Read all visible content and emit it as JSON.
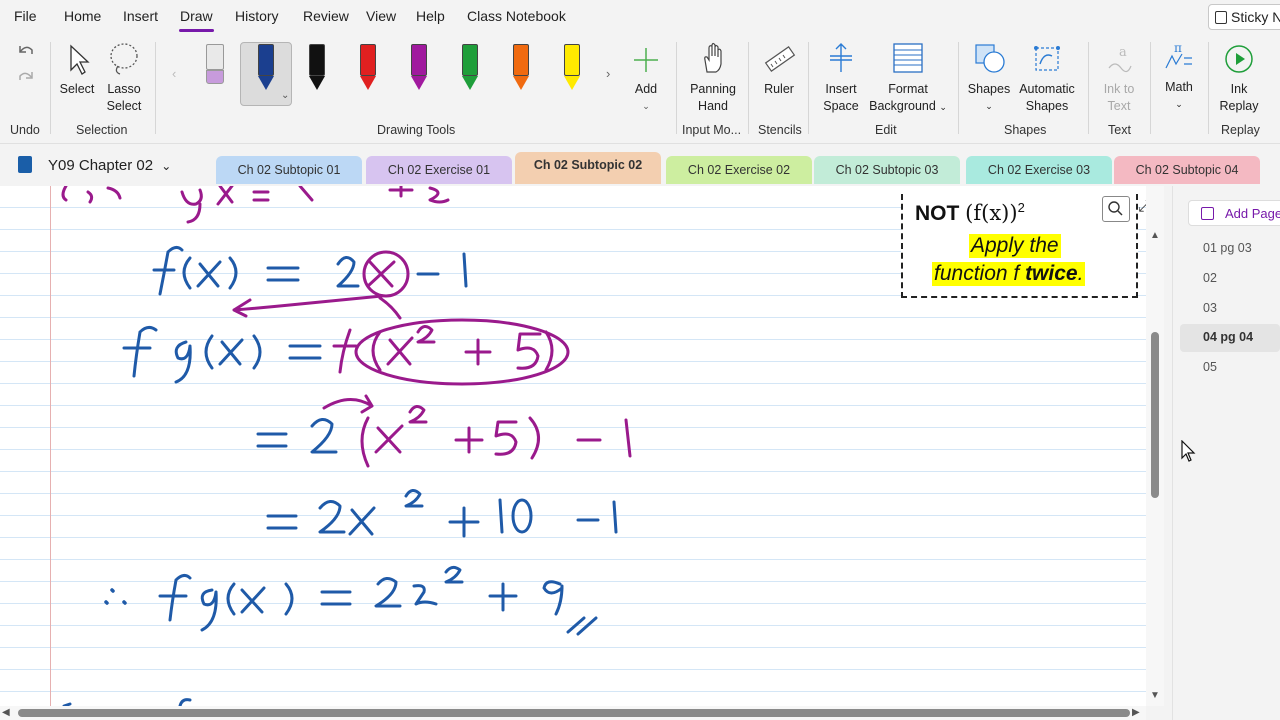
{
  "menu": {
    "file": "File",
    "home": "Home",
    "insert": "Insert",
    "draw": "Draw",
    "history": "History",
    "review": "Review",
    "view": "View",
    "help": "Help",
    "class_notebook": "Class Notebook",
    "sticky_notes": "Sticky N"
  },
  "ribbon": {
    "select": "Select",
    "lasso_select_1": "Lasso",
    "lasso_select_2": "Select",
    "add": "Add",
    "panning_hand_1": "Panning",
    "panning_hand_2": "Hand",
    "ruler": "Ruler",
    "insert_space_1": "Insert",
    "insert_space_2": "Space",
    "format_background_1": "Format",
    "format_background_2": "Background",
    "shapes": "Shapes",
    "automatic_shapes_1": "Automatic",
    "automatic_shapes_2": "Shapes",
    "ink_to_text_1": "Ink to",
    "ink_to_text_2": "Text",
    "math": "Math",
    "ink_replay_1": "Ink",
    "ink_replay_2": "Replay",
    "groups": {
      "undo": "Undo",
      "selection": "Selection",
      "drawing_tools": "Drawing Tools",
      "input_mode": "Input Mo...",
      "stencils": "Stencils",
      "edit": "Edit",
      "shapes": "Shapes",
      "text": "Text",
      "replay": "Replay"
    },
    "pen_colors": [
      "#1b3f8f",
      "#111111",
      "#e02020",
      "#a0199e",
      "#1f9e3a",
      "#f06a10",
      "#ffea00"
    ]
  },
  "notebook": {
    "title": "Y09 Chapter 02",
    "tabs": [
      {
        "label": "Ch 02 Subtopic 01",
        "color": "#bcd8f5"
      },
      {
        "label": "Ch 02 Exercise 01",
        "color": "#d7c4f0"
      },
      {
        "label": "Ch 02 Subtopic 02",
        "color": "#f3cfb0"
      },
      {
        "label": "Ch 02 Exercise 02",
        "color": "#cdeea0"
      },
      {
        "label": "Ch 02 Subtopic 03",
        "color": "#c2ecd8"
      },
      {
        "label": "Ch 02 Exercise 03",
        "color": "#a9eadf"
      },
      {
        "label": "Ch 02 Subtopic 04",
        "color": "#f4b9c2"
      }
    ]
  },
  "note": {
    "not": "NOT",
    "math": "(f(x))",
    "exp": "2",
    "line1": "Apply the",
    "line2_pre": "function f ",
    "line2_bold": "twice",
    "line2_end": "."
  },
  "pages": {
    "add_page": "Add Page",
    "items": [
      "01 pg 03",
      "02",
      "03",
      "04 pg 04",
      "05"
    ],
    "selected": "04 pg 04"
  },
  "colors": {
    "accent": "#7719aa",
    "ink_blue": "#1f5aa8",
    "ink_purple": "#9a1a8c"
  }
}
